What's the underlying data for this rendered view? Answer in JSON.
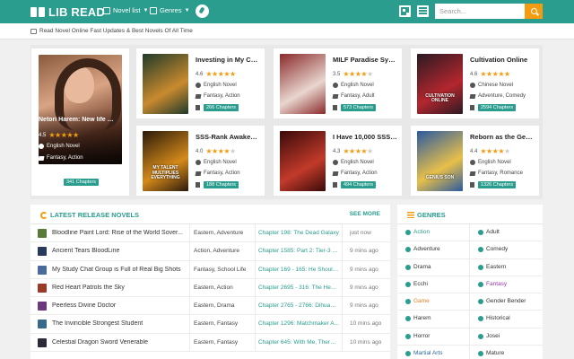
{
  "header": {
    "logo_text": "LIB READ",
    "nav": [
      {
        "label": "Novel list"
      },
      {
        "label": "Genres"
      }
    ],
    "search_placeholder": "Search..."
  },
  "tagline": "Read Novel Online Fast Updates & Best Novels Of All Time",
  "featured": {
    "title": "Netori Harem: New life as...",
    "rating": "4.5",
    "stars": 4.5,
    "language": "English Novel",
    "genres": "Fantasy, Action",
    "chapters": "341 Chapters"
  },
  "hot_novels": [
    {
      "title": "Investing in My Crippl...",
      "rating": "4.6",
      "stars": 4.5,
      "language": "English Novel",
      "genres": "Fantasy, Action",
      "chapters": "266 Chapters",
      "cover_text": "",
      "colors": [
        "#1f3a2a",
        "#c98a2e"
      ]
    },
    {
      "title": "MILF Paradise System",
      "rating": "3.5",
      "stars": 3.5,
      "language": "English Novel",
      "genres": "Fantasy, Adult",
      "chapters": "573 Chapters",
      "cover_text": "",
      "colors": [
        "#8a2a2a",
        "#e9d6cf"
      ]
    },
    {
      "title": "Cultivation Online",
      "rating": "4.6",
      "stars": 4.5,
      "language": "Chinese Novel",
      "genres": "Adventure, Comedy",
      "chapters": "2594 Chapters",
      "cover_text": "CULTIVATION ONLINE",
      "colors": [
        "#2a1a22",
        "#b4262e"
      ]
    },
    {
      "title": "SSS-Rank Awakening...",
      "rating": "4.0",
      "stars": 4,
      "language": "English Novel",
      "genres": "Fantasy, Action",
      "chapters": "188 Chapters",
      "cover_text": "MY TALENT MULTIPLIES EVERYTHING",
      "colors": [
        "#2a1a0a",
        "#d58a1a"
      ]
    },
    {
      "title": "I Have 10,000 SSS Ra...",
      "rating": "4.3",
      "stars": 4,
      "language": "English Novel",
      "genres": "Fantasy, Action",
      "chapters": "494 Chapters",
      "cover_text": "",
      "colors": [
        "#3a0a0a",
        "#c23a2a"
      ]
    },
    {
      "title": "Reborn as the Genius ...",
      "rating": "4.4",
      "stars": 4,
      "language": "English Novel",
      "genres": "Fantasy, Romance",
      "chapters": "1326 Chapters",
      "cover_text": "GENIUS SON",
      "colors": [
        "#2a5aa0",
        "#e8c04a"
      ]
    }
  ],
  "latest": {
    "heading": "LATEST RELEASE NOVELS",
    "see_more": "SEE MORE",
    "rows": [
      {
        "name": "Bloodline Paint Lord: Rise of the World Sover...",
        "genre": "Eastern, Adventure",
        "chapter": "Chapter 198: The Dead Galaxy",
        "time": "just now",
        "color": "#5a7a3a"
      },
      {
        "name": "Ancient Tears BloodLine",
        "genre": "Action, Adventure",
        "chapter": "Chapter 1585: Part 2: Tier-3 S...",
        "time": "9 mins ago",
        "color": "#2a3a5a"
      },
      {
        "name": "My Study Chat Group is Full of Real Big Shots",
        "genre": "Fantasy, School Life",
        "chapter": "Chapter 169 - 165: He Should ...",
        "time": "9 mins ago",
        "color": "#4a6a9a"
      },
      {
        "name": "Red Heart Patrols the Sky",
        "genre": "Eastern, Action",
        "chapter": "Chapter 2695 - 316: The Heav...",
        "time": "9 mins ago",
        "color": "#9a3a2a"
      },
      {
        "name": "Peerless Divine Doctor",
        "genre": "Eastern, Drama",
        "chapter": "Chapter 2765 - 2766: Dihuang ...",
        "time": "9 mins ago",
        "color": "#6a3a7a"
      },
      {
        "name": "The Invincible Strongest Student",
        "genre": "Eastern, Fantasy",
        "chapter": "Chapter 1296: Matchmaker A...",
        "time": "10 mins ago",
        "color": "#3a6a8a"
      },
      {
        "name": "Celestial Dragon Sword Venerable",
        "genre": "Eastern, Fantasy",
        "chapter": "Chapter 645: With Me, There ...",
        "time": "10 mins ago",
        "color": "#2a2a3a"
      }
    ]
  },
  "genres": {
    "heading": "GENRES",
    "items": [
      {
        "label": "Action",
        "color": "#2a9d8f"
      },
      {
        "label": "Adult",
        "color": "#333333"
      },
      {
        "label": "Adventure",
        "color": "#333333"
      },
      {
        "label": "Comedy",
        "color": "#333333"
      },
      {
        "label": "Drama",
        "color": "#333333"
      },
      {
        "label": "Eastern",
        "color": "#333333"
      },
      {
        "label": "Ecchi",
        "color": "#333333"
      },
      {
        "label": "Fantasy",
        "color": "#9b3aa8"
      },
      {
        "label": "Game",
        "color": "#e67e22"
      },
      {
        "label": "Gender Bender",
        "color": "#333333"
      },
      {
        "label": "Harem",
        "color": "#333333"
      },
      {
        "label": "Historical",
        "color": "#333333"
      },
      {
        "label": "Horror",
        "color": "#333333"
      },
      {
        "label": "Josei",
        "color": "#333333"
      },
      {
        "label": "Martial Arts",
        "color": "#2a6aa0"
      },
      {
        "label": "Mature",
        "color": "#333333"
      }
    ]
  }
}
